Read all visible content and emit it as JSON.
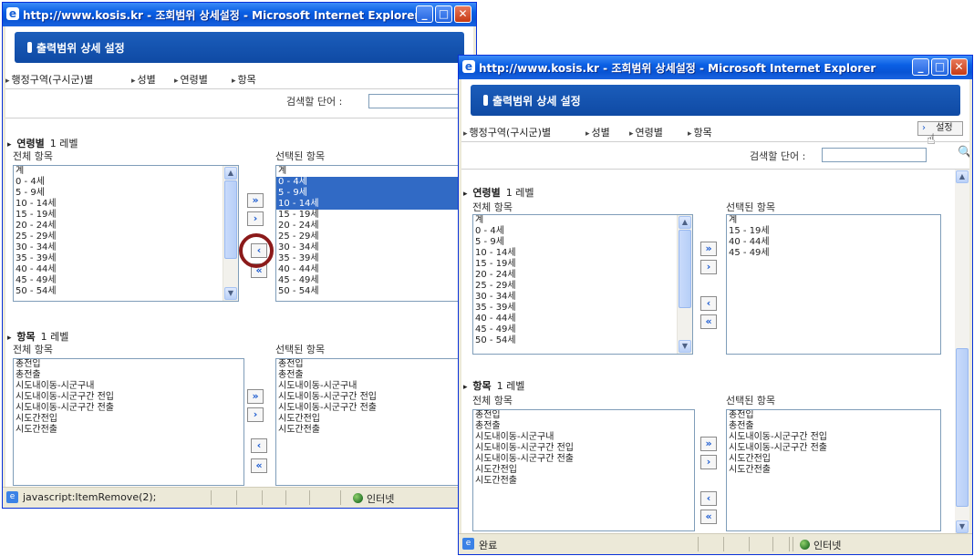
{
  "window": {
    "title": "http://www.kosis.kr - 조회범위 상세설정 - Microsoft Internet Explorer",
    "min_glyph": "_",
    "max_glyph": "□",
    "close_glyph": "✕"
  },
  "banner": {
    "title": "출력범위 상세 설정"
  },
  "tabs": [
    "행정구역(구시군)별",
    "성별",
    "연령별",
    "항목"
  ],
  "settings_button": {
    "arrow": "›",
    "label": "설정"
  },
  "search": {
    "label": "검색할 단어 :",
    "value": ""
  },
  "age_section": {
    "title": "연령별",
    "level": "1 레벨",
    "all_label": "전체 항목",
    "selected_label": "선택된 항목",
    "all_items": [
      "계",
      "0 - 4세",
      "5 - 9세",
      "10 - 14세",
      "15 - 19세",
      "20 - 24세",
      "25 - 29세",
      "30 - 34세",
      "35 - 39세",
      "40 - 44세",
      "45 - 49세",
      "50 - 54세"
    ],
    "left_selected_items": [
      "계",
      "0 - 4세",
      "5 - 9세",
      "10 - 14세",
      "15 - 19세",
      "20 - 24세",
      "25 - 29세",
      "30 - 34세",
      "35 - 39세",
      "40 - 44세",
      "45 - 49세",
      "50 - 54세"
    ],
    "right_selected_items": [
      "계",
      "15 - 19세",
      "40 - 44세",
      "45 - 49세"
    ]
  },
  "item_section": {
    "title": "항목",
    "level": "1 레벨",
    "all_label": "전체 항목",
    "selected_label": "선택된 항목",
    "all_items": [
      "총전입",
      "총전출",
      "시도내이동-시군구내",
      "시도내이동-시군구간 전입",
      "시도내이동-시군구간 전출",
      "시도간전입",
      "시도간전출"
    ],
    "selected_items": [
      "총전입",
      "총전출",
      "시도내이동-시군구내",
      "시도내이동-시군구간 전입",
      "시도내이동-시군구간 전출",
      "시도간전입",
      "시도간전출"
    ],
    "right_selected_items": [
      "총전입",
      "총전출",
      "시도내이동-시군구간 전입",
      "시도내이동-시군구간 전출",
      "시도간전입",
      "시도간전출"
    ]
  },
  "transfer_buttons": {
    "add_all": "»",
    "add": "›",
    "remove": "‹",
    "remove_all": "«"
  },
  "status_left": {
    "text": "javascript:ItemRemove(2);",
    "zone": "인터넷"
  },
  "status_right": {
    "text": "완료",
    "zone": "인터넷"
  },
  "highlight_color": "#316ac5",
  "annotation_color": "#8b1a1a"
}
